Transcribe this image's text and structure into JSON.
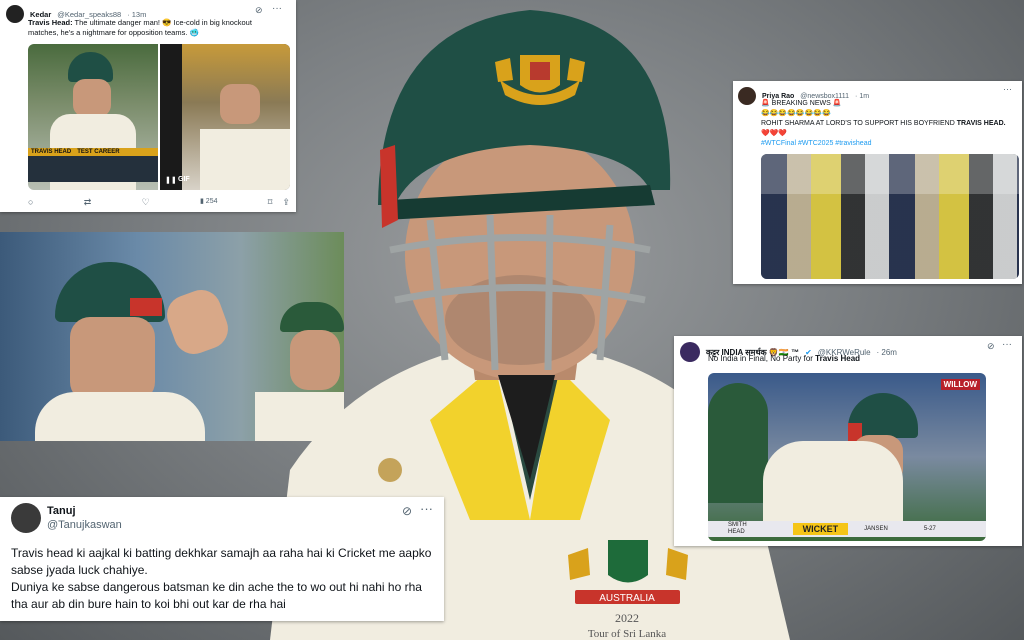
{
  "tweet_kedar": {
    "name": "Kedar",
    "handle": "@Kedar_speaks88",
    "time": "· 13m",
    "text_bold": "Travis Head:",
    "text": " The ultimate danger man! 😎 Ice-cold in big knockout matches, he's a nightmare for opposition teams. 🥶",
    "stats_label": "TRAVIS HEAD",
    "stats_sub": "TEST CAREER",
    "gif_label": "GIF",
    "views": "254"
  },
  "tweet_priya": {
    "name": "Priya Rao",
    "handle": "@newsbox1111",
    "time": "· 1m",
    "line1": "🚨 BREAKING NEWS 🚨",
    "line2": "😂😂😂😂😂😂😂😂",
    "line3_pre": "ROHIT SHARMA AT LORD'S TO SUPPORT HIS BOYFRIEND ",
    "line3_bold": "TRAVIS HEAD.",
    "line4": "❤️❤️❤️",
    "hashtags": "#WTCFinal #WTC2025 #travishead"
  },
  "tweet_kkr": {
    "name": "कट्टर INDIA समर्थक 🦁🇮🇳 ™",
    "handle": "@KKRWeRule",
    "time": "· 26m",
    "text_pre": "No India in Final, No Party for ",
    "text_bold": "Travis Head",
    "broadcaster": "WILLOW",
    "scorebar_p1": "SMITH",
    "scorebar_p2": "HEAD",
    "scorebar_event": "WICKET",
    "scorebar_bowler": "JANSEN",
    "scorebar_figures": "5-27"
  },
  "tweet_tanuj": {
    "name": "Tanuj",
    "handle": "@Tanujkaswan",
    "line1": "Travis head ki aajkal ki batting dekhkar samajh aa raha hai ki Cricket me aapko sabse jyada luck chahiye.",
    "line2": "Duniya ke sabse dangerous batsman ke din ache the to wo out hi nahi ho rha tha aur ab din bure hain to koi bhi out kar de rha hai"
  },
  "jersey": {
    "badge_text": "AUSTRALIA",
    "tour_year": "2022",
    "tour_text": "Tour of Sri Lanka"
  },
  "colors": {
    "helmet_green": "#1f4f45",
    "cap_gold": "#d9a21b",
    "link_blue": "#1d9bf0",
    "shirt_cream": "#f1ede0",
    "collar_yellow": "#f2d22c",
    "wicket_yellow": "#f5c518"
  }
}
